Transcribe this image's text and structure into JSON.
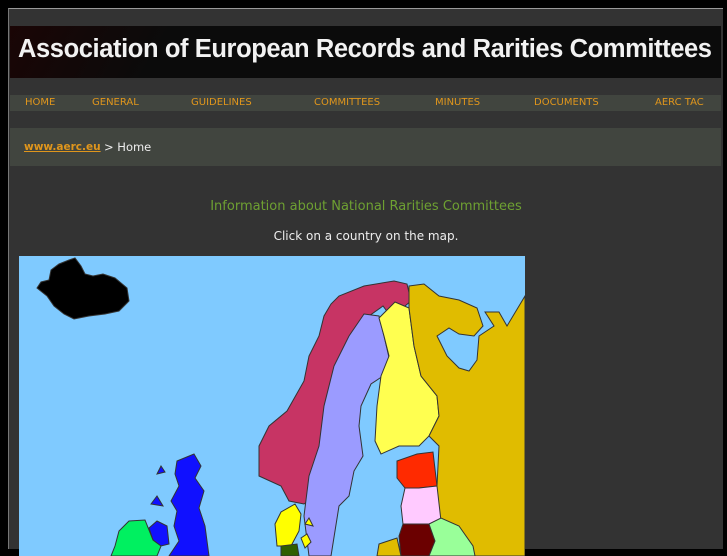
{
  "header": {
    "title": "Association of European Records and Rarities Committees"
  },
  "nav": [
    {
      "label": "HOME"
    },
    {
      "label": "GENERAL"
    },
    {
      "label": "GUIDELINES"
    },
    {
      "label": "COMMITTEES"
    },
    {
      "label": "MINUTES"
    },
    {
      "label": "DOCUMENTS"
    },
    {
      "label": "AERC TAC"
    }
  ],
  "breadcrumb": {
    "site": "www.aerc.eu",
    "separator": " > ",
    "current": "Home"
  },
  "main": {
    "heading": "Information about National Rarities Committees",
    "instruction": "Click on a country on the map."
  },
  "colors": {
    "accent": "#e0961c",
    "heading": "#6ea032",
    "sea": "#7fcaff"
  }
}
